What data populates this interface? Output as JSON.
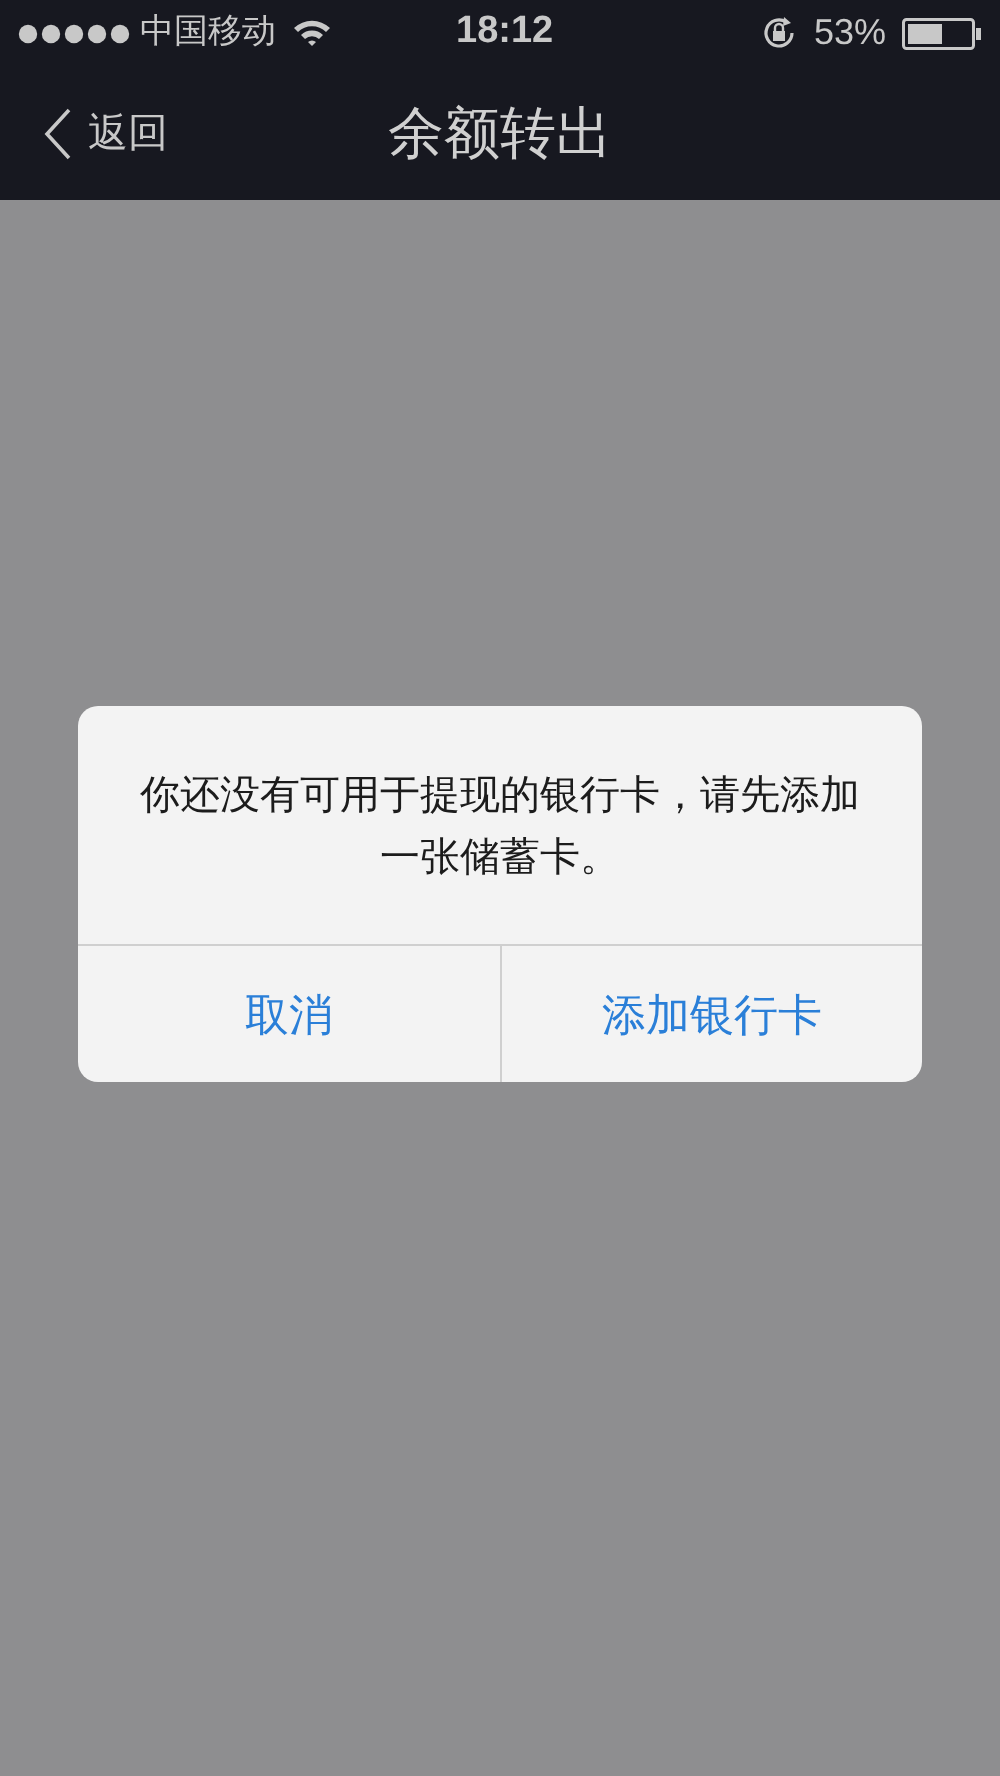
{
  "status_bar": {
    "carrier": "中国移动",
    "time": "18:12",
    "battery": "53%"
  },
  "nav_bar": {
    "back": "返回",
    "title": "余额转出"
  },
  "dialog": {
    "message": "你还没有可用于提现的银行卡，请先添加一张储蓄卡。",
    "buttons": [
      {
        "label": "取消"
      },
      {
        "label": "添加银行卡"
      }
    ]
  }
}
